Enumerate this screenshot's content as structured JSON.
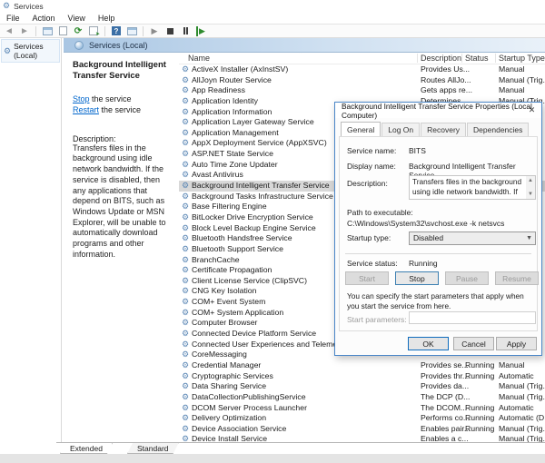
{
  "window": {
    "title": "Services"
  },
  "menu": {
    "items": [
      "File",
      "Action",
      "View",
      "Help"
    ]
  },
  "tree": {
    "root": "Services (Local)"
  },
  "pane_header": {
    "title": "Services (Local)"
  },
  "left_panel": {
    "service_title": "Background Intelligent Transfer Service",
    "stop_link": "Stop",
    "stop_rest": " the service",
    "restart_link": "Restart",
    "restart_rest": " the service",
    "description_label": "Description:",
    "description": "Transfers files in the background using idle network bandwidth. If the service is disabled, then any applications that depend on BITS, such as Windows Update or MSN Explorer, will be unable to automatically download programs and other information."
  },
  "list": {
    "columns": [
      "Name",
      "Description",
      "Status",
      "Startup Type"
    ],
    "rows": [
      {
        "name": "ActiveX Installer (AxInstSV)",
        "desc": "Provides Us...",
        "status": "",
        "startup": "Manual",
        "selected": false
      },
      {
        "name": "AllJoyn Router Service",
        "desc": "Routes AllJo...",
        "status": "",
        "startup": "Manual (Trig...",
        "selected": false
      },
      {
        "name": "App Readiness",
        "desc": "Gets apps re...",
        "status": "",
        "startup": "Manual",
        "selected": false
      },
      {
        "name": "Application Identity",
        "desc": "Determines...",
        "status": "",
        "startup": "Manual (Trig...",
        "selected": false
      },
      {
        "name": "Application Information",
        "desc": "",
        "status": "",
        "startup": "",
        "selected": false
      },
      {
        "name": "Application Layer Gateway Service",
        "desc": "",
        "status": "",
        "startup": "",
        "selected": false
      },
      {
        "name": "Application Management",
        "desc": "",
        "status": "",
        "startup": "",
        "selected": false
      },
      {
        "name": "AppX Deployment Service (AppXSVC)",
        "desc": "",
        "status": "",
        "startup": "",
        "selected": false
      },
      {
        "name": "ASP.NET State Service",
        "desc": "",
        "status": "",
        "startup": "",
        "selected": false
      },
      {
        "name": "Auto Time Zone Updater",
        "desc": "",
        "status": "",
        "startup": "",
        "selected": false
      },
      {
        "name": "Avast Antivirus",
        "desc": "",
        "status": "",
        "startup": "",
        "selected": false
      },
      {
        "name": "Background Intelligent Transfer Service",
        "desc": "",
        "status": "",
        "startup": "",
        "selected": true
      },
      {
        "name": "Background Tasks Infrastructure Service",
        "desc": "",
        "status": "",
        "startup": "",
        "selected": false
      },
      {
        "name": "Base Filtering Engine",
        "desc": "",
        "status": "",
        "startup": "",
        "selected": false
      },
      {
        "name": "BitLocker Drive Encryption Service",
        "desc": "",
        "status": "",
        "startup": "",
        "selected": false
      },
      {
        "name": "Block Level Backup Engine Service",
        "desc": "",
        "status": "",
        "startup": "",
        "selected": false
      },
      {
        "name": "Bluetooth Handsfree Service",
        "desc": "",
        "status": "",
        "startup": "",
        "selected": false
      },
      {
        "name": "Bluetooth Support Service",
        "desc": "",
        "status": "",
        "startup": "",
        "selected": false
      },
      {
        "name": "BranchCache",
        "desc": "",
        "status": "",
        "startup": "",
        "selected": false
      },
      {
        "name": "Certificate Propagation",
        "desc": "",
        "status": "",
        "startup": "",
        "selected": false
      },
      {
        "name": "Client License Service (ClipSVC)",
        "desc": "",
        "status": "",
        "startup": "",
        "selected": false
      },
      {
        "name": "CNG Key Isolation",
        "desc": "",
        "status": "",
        "startup": "",
        "selected": false
      },
      {
        "name": "COM+ Event System",
        "desc": "",
        "status": "",
        "startup": "",
        "selected": false
      },
      {
        "name": "COM+ System Application",
        "desc": "",
        "status": "",
        "startup": "",
        "selected": false
      },
      {
        "name": "Computer Browser",
        "desc": "",
        "status": "",
        "startup": "",
        "selected": false
      },
      {
        "name": "Connected Device Platform Service",
        "desc": "",
        "status": "",
        "startup": "",
        "selected": false
      },
      {
        "name": "Connected User Experiences and Telemetry",
        "desc": "",
        "status": "",
        "startup": "",
        "selected": false
      },
      {
        "name": "CoreMessaging",
        "desc": "",
        "status": "",
        "startup": "",
        "selected": false
      },
      {
        "name": "Credential Manager",
        "desc": "Provides se...",
        "status": "Running",
        "startup": "Manual",
        "selected": false
      },
      {
        "name": "Cryptographic Services",
        "desc": "Provides thr...",
        "status": "Running",
        "startup": "Automatic",
        "selected": false
      },
      {
        "name": "Data Sharing Service",
        "desc": "Provides da...",
        "status": "",
        "startup": "Manual (Trig...",
        "selected": false
      },
      {
        "name": "DataCollectionPublishingService",
        "desc": "The DCP (D...",
        "status": "",
        "startup": "Manual (Trig...",
        "selected": false
      },
      {
        "name": "DCOM Server Process Launcher",
        "desc": "The DCOM...",
        "status": "Running",
        "startup": "Automatic",
        "selected": false
      },
      {
        "name": "Delivery Optimization",
        "desc": "Performs co...",
        "status": "Running",
        "startup": "Automatic (D...",
        "selected": false
      },
      {
        "name": "Device Association Service",
        "desc": "Enables pair...",
        "status": "Running",
        "startup": "Manual (Trig...",
        "selected": false
      },
      {
        "name": "Device Install Service",
        "desc": "Enables a c...",
        "status": "",
        "startup": "Manual (Trig...",
        "selected": false
      },
      {
        "name": "",
        "desc": "",
        "status": "",
        "startup": "",
        "selected": false
      }
    ]
  },
  "bottom_tabs": {
    "extended": "Extended",
    "standard": "Standard"
  },
  "dialog": {
    "title": "Background Intelligent Transfer Service Properties (Local Computer)",
    "close_glyph": "✕",
    "tabs": [
      "General",
      "Log On",
      "Recovery",
      "Dependencies"
    ],
    "fields": {
      "service_name_label": "Service name:",
      "service_name": "BITS",
      "display_name_label": "Display name:",
      "display_name": "Background Intelligent Transfer Service",
      "description_label": "Description:",
      "description": "Transfers files in the background using idle network bandwidth. If the service is disabled, then any",
      "path_label": "Path to executable:",
      "path": "C:\\Windows\\System32\\svchost.exe -k netsvcs",
      "startup_label": "Startup type:",
      "startup_value": "Disabled",
      "status_label": "Service status:",
      "status_value": "Running",
      "start_params_label": "Start parameters:"
    },
    "note": "You can specify the start parameters that apply when you start the service from here.",
    "buttons": {
      "start": "Start",
      "stop": "Stop",
      "pause": "Pause",
      "resume": "Resume",
      "ok": "OK",
      "cancel": "Cancel",
      "apply": "Apply"
    }
  },
  "colors": {
    "accent_blue": "#4a86c8",
    "link_blue": "#0066cc",
    "selected_row": "#d8d8d8",
    "header_gradient_left": "#a9c6e3",
    "ok_border": "#0f6cbd",
    "gear_icon": "#5b87b5"
  }
}
